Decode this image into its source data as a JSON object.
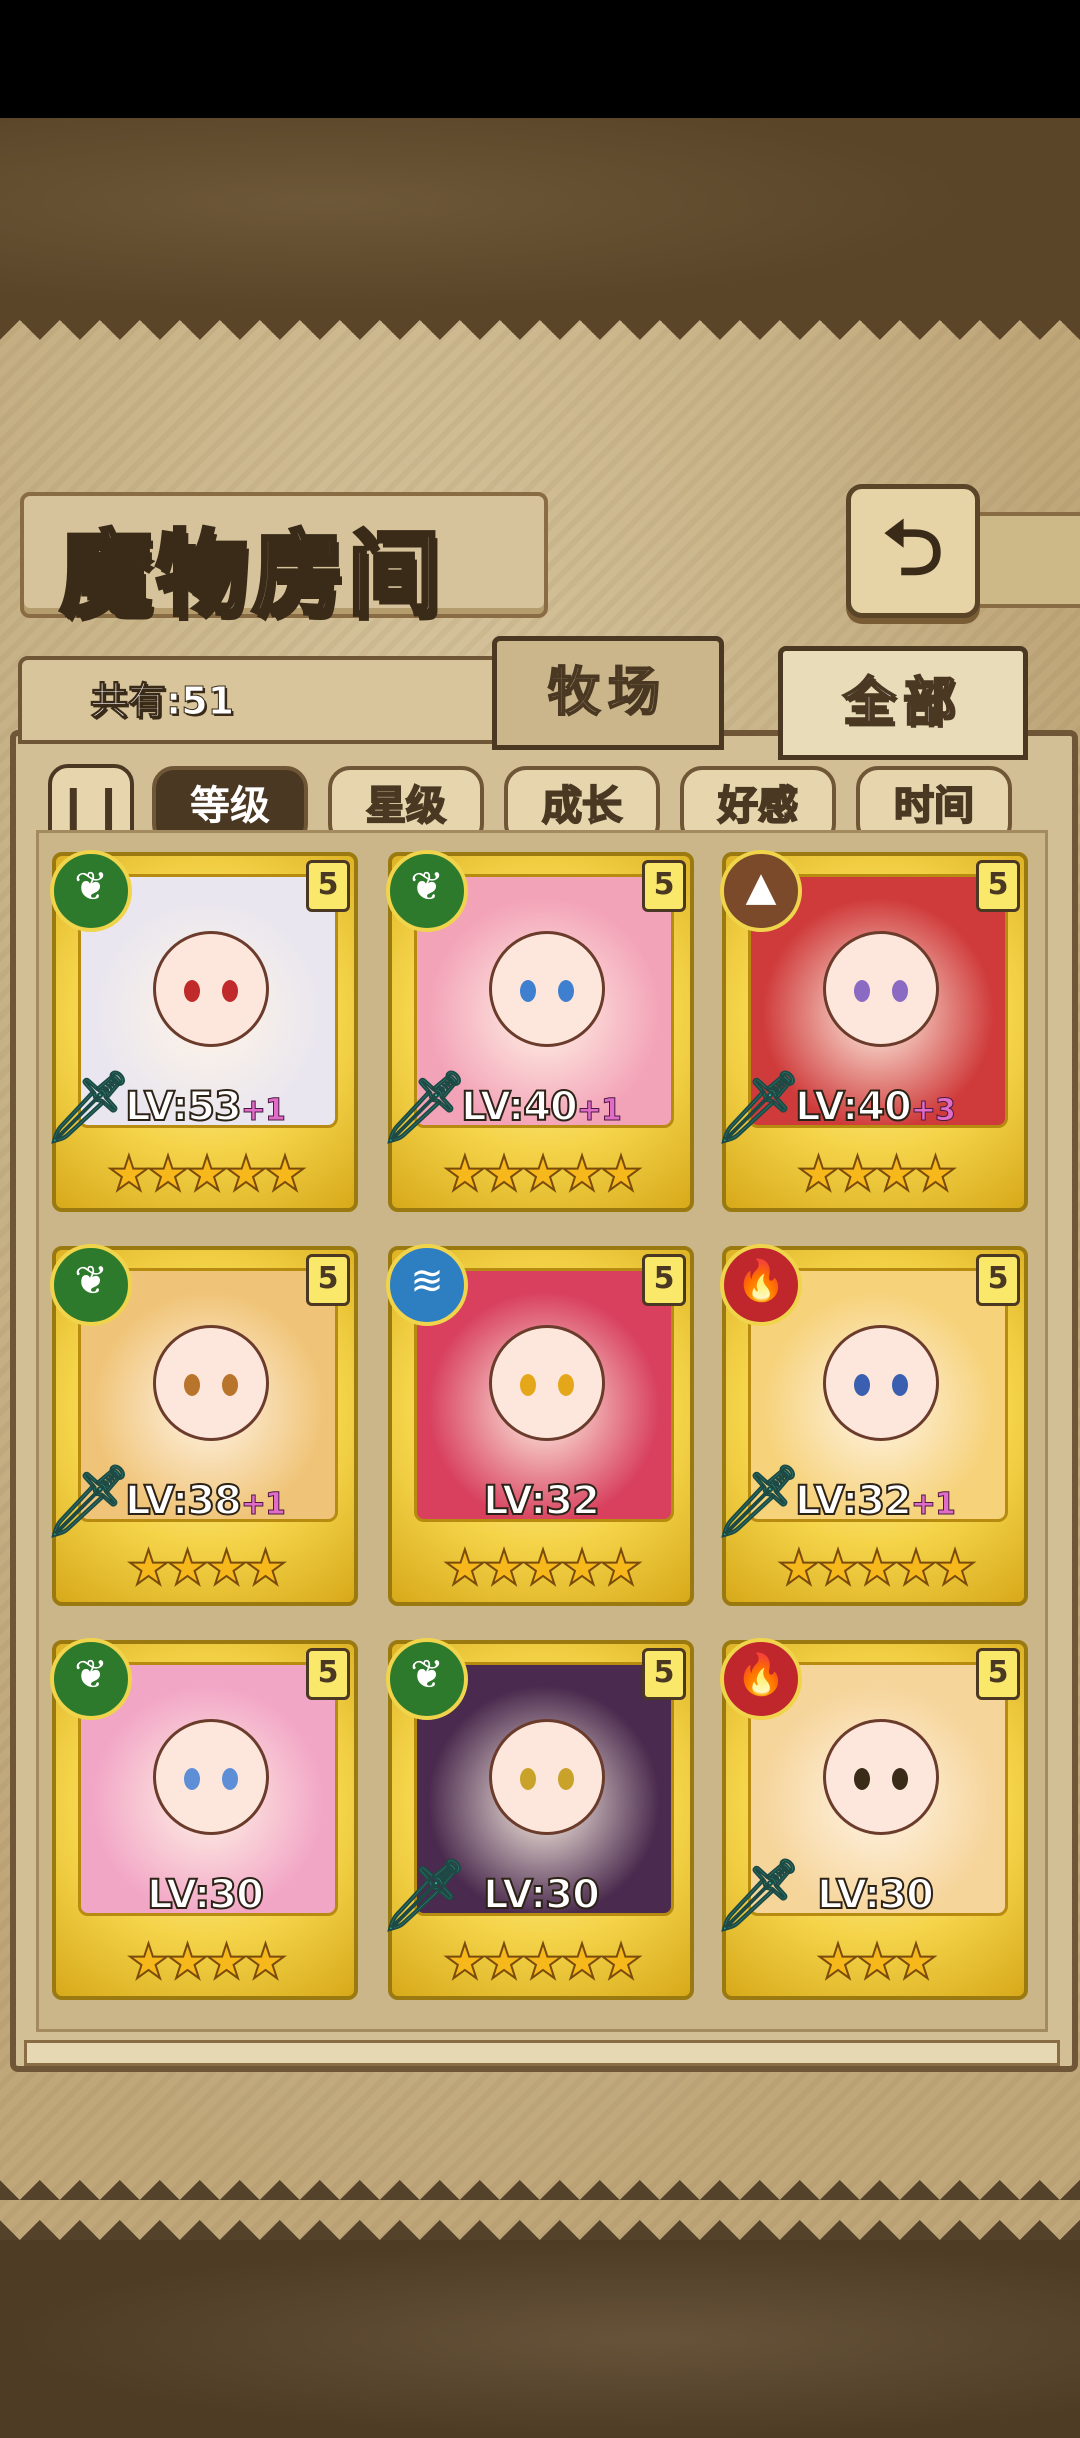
{
  "title": "魔物房间",
  "back_icon": "back-arrow-icon",
  "count_label": "共有:51",
  "tabs": [
    {
      "label": "牧场",
      "active": false
    },
    {
      "label": "全部",
      "active": true
    }
  ],
  "sort_toggle_icon": "pause-icon",
  "sort_buttons": [
    {
      "label": "等级",
      "active": true
    },
    {
      "label": "星级",
      "active": false
    },
    {
      "label": "成长",
      "active": false
    },
    {
      "label": "好感",
      "active": false
    },
    {
      "label": "时间",
      "active": false
    }
  ],
  "colors": {
    "grass": "#2e7a2c",
    "water": "#2d7fc2",
    "fire": "#c0272d",
    "earth": "#7a4a2a"
  },
  "monsters": [
    {
      "element": "grass",
      "element_icon": "leaf-icon",
      "rarity": "5",
      "weapon_icon": "sword-icon",
      "lv": "LV:53",
      "plus": "+1",
      "stars": "★★★★★",
      "hair": "#e9e6ef",
      "eye": "#c02a2a"
    },
    {
      "element": "grass",
      "element_icon": "leaf-icon",
      "rarity": "5",
      "weapon_icon": "sword-icon",
      "lv": "LV:40",
      "plus": "+1",
      "stars": "★★★★★",
      "hair": "#f3a3b8",
      "eye": "#3f7fd0"
    },
    {
      "element": "earth",
      "element_icon": "mountain-icon",
      "rarity": "5",
      "weapon_icon": "sword-icon",
      "lv": "LV:40",
      "plus": "+3",
      "stars": "★★★★",
      "hair": "#cf3b3b",
      "eye": "#8a6ac2"
    },
    {
      "element": "grass",
      "element_icon": "leaf-icon",
      "rarity": "5",
      "weapon_icon": "sword-icon",
      "lv": "LV:38",
      "plus": "+1",
      "stars": "★★★★",
      "hair": "#f0c478",
      "eye": "#b8742a"
    },
    {
      "element": "water",
      "element_icon": "water-wave-icon",
      "rarity": "5",
      "weapon_icon": "",
      "lv": "LV:32",
      "plus": "",
      "stars": "★★★★★",
      "hair": "#d8405e",
      "eye": "#e5a71a"
    },
    {
      "element": "fire",
      "element_icon": "flame-icon",
      "rarity": "5",
      "weapon_icon": "sword-icon",
      "lv": "LV:32",
      "plus": "+1",
      "stars": "★★★★★",
      "hair": "#f6d27a",
      "eye": "#3a5fb0"
    },
    {
      "element": "grass",
      "element_icon": "leaf-icon",
      "rarity": "5",
      "weapon_icon": "",
      "lv": "LV:30",
      "plus": "",
      "stars": "★★★★",
      "hair": "#f2a6c6",
      "eye": "#5e8fd6"
    },
    {
      "element": "grass",
      "element_icon": "leaf-icon",
      "rarity": "5",
      "weapon_icon": "sword-icon",
      "lv": "LV:30",
      "plus": "",
      "stars": "★★★★★",
      "hair": "#4a2a4e",
      "eye": "#c9a22a"
    },
    {
      "element": "fire",
      "element_icon": "flame-icon",
      "rarity": "5",
      "weapon_icon": "sword-icon",
      "lv": "LV:30",
      "plus": "",
      "stars": "★★★",
      "hair": "#f6d59b",
      "eye": "#3a2a18"
    }
  ]
}
